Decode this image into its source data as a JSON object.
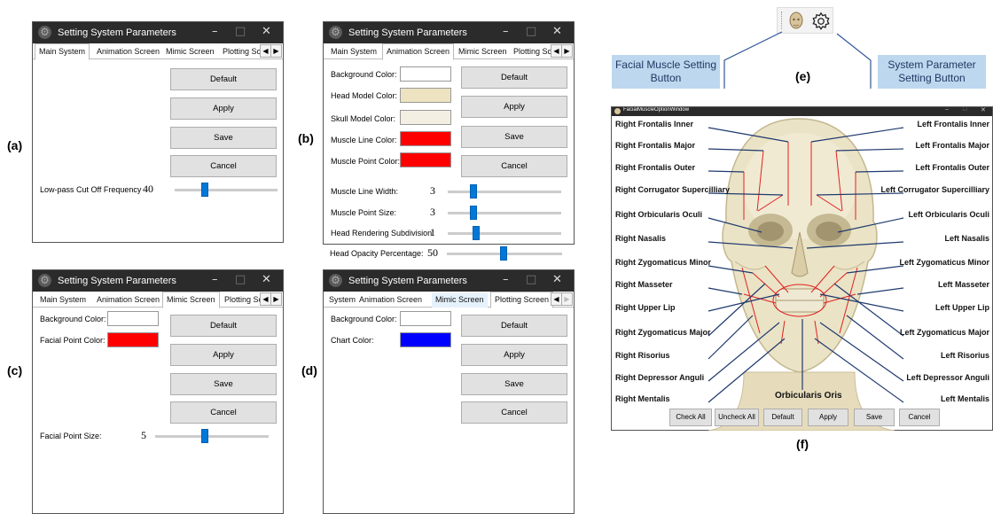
{
  "panel_labels": {
    "a": "(a)",
    "b": "(b)",
    "c": "(c)",
    "d": "(d)",
    "e": "(e)",
    "f": "(f)"
  },
  "window_title": "Setting System Parameters",
  "window_buttons": {
    "minimize": "–",
    "maximize": "□",
    "close": "✕"
  },
  "scroll_left": "◀",
  "scroll_right": "▶",
  "win_a": {
    "tabs": [
      "Main System",
      "Animation Screen",
      "Mimic Screen",
      "Plotting Scr"
    ],
    "buttons": [
      "Default",
      "Apply",
      "Save",
      "Cancel"
    ],
    "slider_label": "Low-pass Cut Off Frequency",
    "slider_value": "40",
    "slider_level": 0.29
  },
  "win_b": {
    "tabs": [
      "Main System",
      "Animation Screen",
      "Mimic Screen",
      "Plotting Scr"
    ],
    "color_fields": [
      {
        "label": "Background Color:",
        "color": "#ffffff"
      },
      {
        "label": "Head Model Color:",
        "color": "#ede3c0"
      },
      {
        "label": "Skull Model Color:",
        "color": "#f3efe2"
      },
      {
        "label": "Muscle Line Color:",
        "color": "#ff0000"
      },
      {
        "label": "Muscle Point Color:",
        "color": "#ff0000"
      }
    ],
    "buttons": [
      "Default",
      "Apply",
      "Save",
      "Cancel"
    ],
    "sliders": [
      {
        "label": "Muscle Line Width:",
        "value": "3",
        "level": 0.23
      },
      {
        "label": "Muscle Point Size:",
        "value": "3",
        "level": 0.23
      },
      {
        "label": "Head Rendering Subdivision:",
        "value": "1",
        "level": 0.25
      },
      {
        "label": "Head Opacity Percentage:",
        "value": "50",
        "level": 0.49
      }
    ]
  },
  "win_c": {
    "tabs": [
      "Main System",
      "Animation Screen",
      "Mimic Screen",
      "Plotting Scr"
    ],
    "color_fields": [
      {
        "label": "Background Color:",
        "color": "#ffffff"
      },
      {
        "label": "Facial Point Color:",
        "color": "#ff0000"
      }
    ],
    "buttons": [
      "Default",
      "Apply",
      "Save",
      "Cancel"
    ],
    "slider_label": "Facial Point Size:",
    "slider_value": "5",
    "slider_level": 0.44
  },
  "win_d": {
    "tabs": [
      "System",
      "Animation Screen",
      "Mimic Screen",
      "Plotting Screen"
    ],
    "color_fields": [
      {
        "label": "Background Color:",
        "color": "#ffffff"
      },
      {
        "label": "Chart Color:",
        "color": "#0000ff"
      }
    ],
    "buttons": [
      "Default",
      "Apply",
      "Save",
      "Cancel"
    ]
  },
  "callouts": {
    "left": "Facial Muscle Setting Button",
    "right": "System Parameter Setting Button"
  },
  "facial_window": {
    "title": "FacialMuscleOptionWindow",
    "left_labels": [
      "Right Frontalis Inner",
      "Right Frontalis Major",
      "Right Frontalis Outer",
      "Right Corrugator Supercilliary",
      "Right Orbicularis Oculi",
      "Right Nasalis",
      "Right Zygomaticus Minor",
      "Right Masseter",
      "Right Upper Lip",
      "Right Zygomaticus Major",
      "Right Risorius",
      "Right Depressor Anguli",
      "Right Mentalis"
    ],
    "right_labels": [
      "Left Frontalis Inner",
      "Left Frontalis Major",
      "Left Frontalis Outer",
      "Left Corrugator Supercilliary",
      "Left Orbicularis Oculi",
      "Left Nasalis",
      "Left Zygomaticus Minor",
      "Left Masseter",
      "Left Upper Lip",
      "Left Zygomaticus Major",
      "Left Risorius",
      "Left Depressor Anguli",
      "Left Mentalis"
    ],
    "center_label": "Orbicularis Oris",
    "buttons": [
      "Check All",
      "Uncheck All",
      "Default",
      "Apply",
      "Save",
      "Cancel"
    ]
  },
  "colors": {
    "titlebar": "#2b2b2b",
    "slider": "#0078d7",
    "callout": "#bdd7ee"
  }
}
